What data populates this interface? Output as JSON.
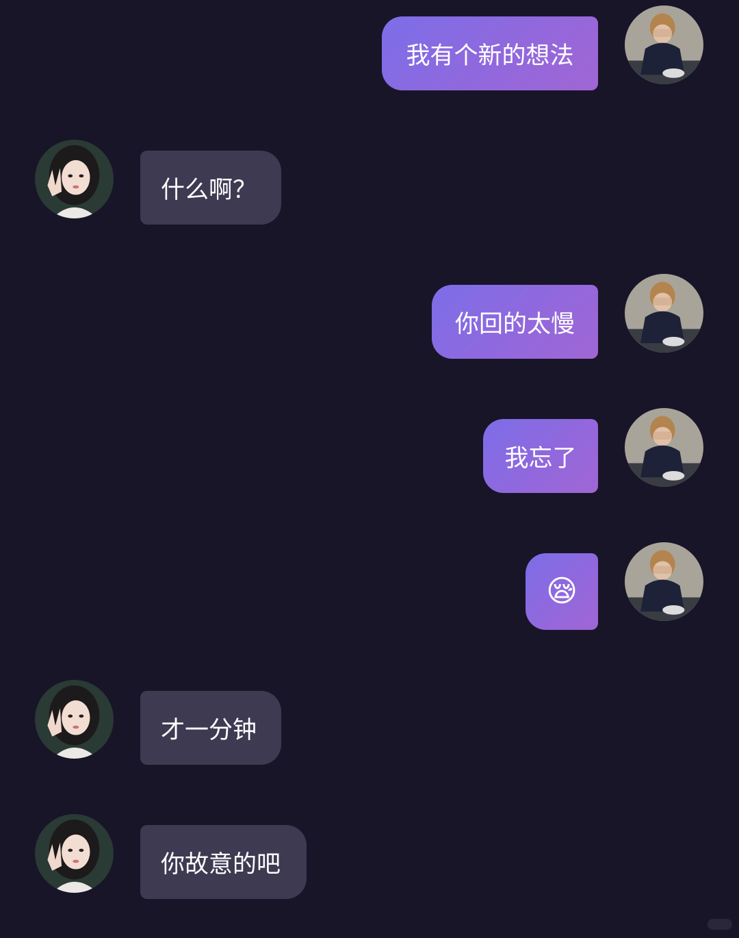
{
  "messages": [
    {
      "from": "me",
      "text": "我有个新的想法"
    },
    {
      "from": "other",
      "text": "什么啊？"
    },
    {
      "from": "me",
      "text": "你回的太慢"
    },
    {
      "from": "me",
      "text": "我忘了"
    },
    {
      "from": "me",
      "text": "😪"
    },
    {
      "from": "other",
      "text": "才一分钟"
    },
    {
      "from": "other",
      "text": "你故意的吧"
    }
  ],
  "avatars": {
    "me": "avatar-boy-covering-face",
    "other": "avatar-girl-peace-sign"
  },
  "colors": {
    "background": "#181528",
    "bubble_out": "#8b6ae2",
    "bubble_in": "#3d3a52"
  }
}
